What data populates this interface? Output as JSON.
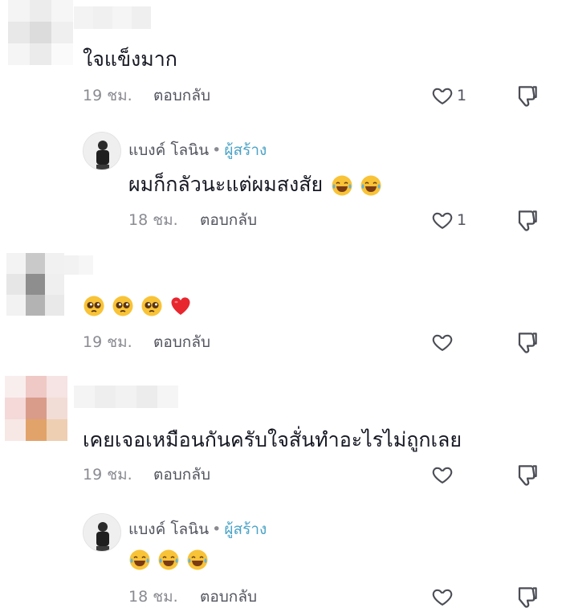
{
  "comments": [
    {
      "text": "ใจแข็งมาก",
      "time": "19 ชม.",
      "reply_label": "ตอบกลับ",
      "likes": "1"
    },
    {
      "author": "แบงค์ โลนิน",
      "badge": "ผู้สร้าง",
      "text": "ผมก็กลัวนะแต่ผมสงสัย",
      "emojis": [
        "laugh-cry-emoji",
        "laugh-cry-emoji"
      ],
      "time": "18 ชม.",
      "reply_label": "ตอบกลับ",
      "likes": "1"
    },
    {
      "emojis": [
        "pleading-emoji",
        "pleading-emoji",
        "pleading-emoji",
        "red-heart-emoji"
      ],
      "time": "19 ชม.",
      "reply_label": "ตอบกลับ"
    },
    {
      "text": "เคยเจอเหมือนกันครับใจสั่นทำอะไรไม่ถูกเลย",
      "time": "19 ชม.",
      "reply_label": "ตอบกลับ"
    },
    {
      "author": "แบงค์ โลนิน",
      "badge": "ผู้สร้าง",
      "emojis": [
        "laugh-cry-emoji",
        "laugh-cry-emoji",
        "laugh-cry-emoji"
      ],
      "time": "18 ชม.",
      "reply_label": "ตอบกลับ"
    }
  ],
  "colors": {
    "text": "#161823",
    "meta": "#8a8b91",
    "creator_badge": "#4aa3c7",
    "heart_emoji": "#e8262e"
  },
  "icons": [
    "heart-outline-icon",
    "thumbs-down-icon"
  ]
}
